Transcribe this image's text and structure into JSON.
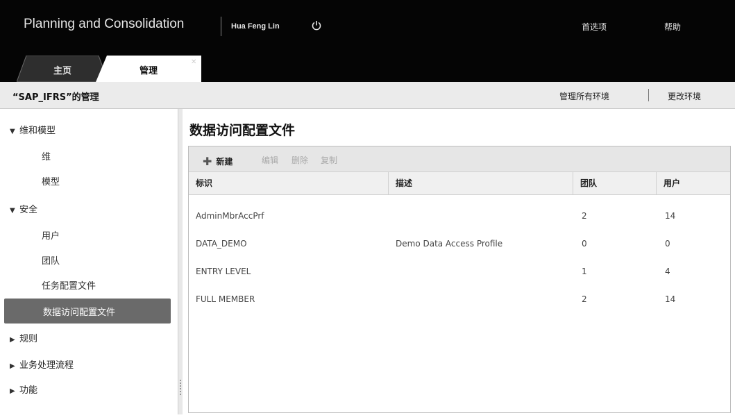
{
  "header": {
    "app_title": "Planning and Consolidation",
    "user_name": "Hua Feng Lin",
    "preferences": "首选项",
    "help": "帮助"
  },
  "tabs": [
    {
      "label": "主页"
    },
    {
      "label": "管理"
    }
  ],
  "subbar": {
    "title": "“SAP_IFRS”的管理",
    "manage_all": "管理所有环境",
    "change_env": "更改环境"
  },
  "sidebar": {
    "groups": [
      {
        "label": "维和模型",
        "expanded": true,
        "items": [
          "维",
          "模型"
        ]
      },
      {
        "label": "安全",
        "expanded": true,
        "items": [
          "用户",
          "团队",
          "任务配置文件",
          "数据访问配置文件"
        ]
      },
      {
        "label": "规则",
        "expanded": false
      },
      {
        "label": "业务处理流程",
        "expanded": false
      },
      {
        "label": "功能",
        "expanded": false
      }
    ],
    "active_item": "数据访问配置文件"
  },
  "main": {
    "title": "数据访问配置文件",
    "toolbar": {
      "new": "新建",
      "edit": "编辑",
      "delete": "删除",
      "copy": "复制"
    },
    "columns": [
      "标识",
      "描述",
      "团队",
      "用户"
    ],
    "rows": [
      {
        "id": "AdminMbrAccPrf",
        "desc": "",
        "teams": "2",
        "users": "14"
      },
      {
        "id": "DATA_DEMO",
        "desc": "Demo Data Access Profile",
        "teams": "0",
        "users": "0"
      },
      {
        "id": "ENTRY LEVEL",
        "desc": "",
        "teams": "1",
        "users": "4"
      },
      {
        "id": "FULL MEMBER",
        "desc": "",
        "teams": "2",
        "users": "14"
      }
    ]
  }
}
